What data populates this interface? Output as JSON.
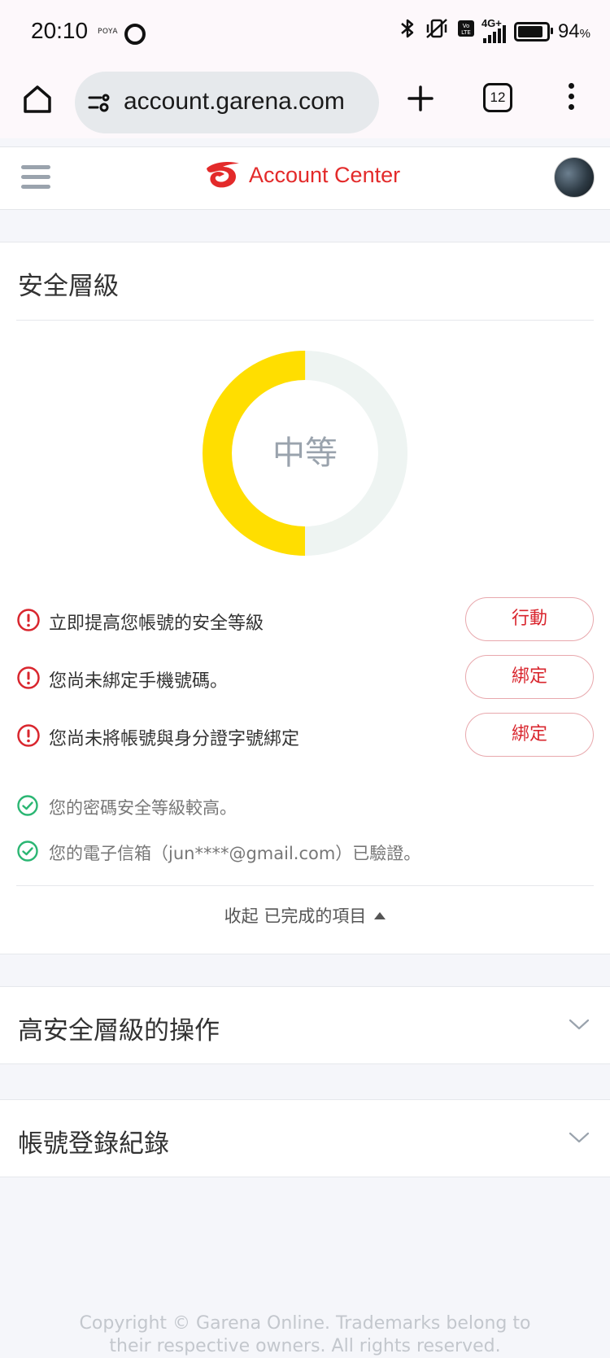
{
  "status_bar": {
    "time": "20:10",
    "carrier_label": "POYA",
    "network": "4G+",
    "battery": "94",
    "battery_unit": "%",
    "battery_level": 0.94
  },
  "browser": {
    "url": "account.garena.com",
    "tab_count": "12"
  },
  "header": {
    "title": "Account Center",
    "brand_color": "#e32a2a"
  },
  "security": {
    "title": "安全層級",
    "level_label": "中等",
    "level_fraction": 0.5,
    "level_color": "#ffde00",
    "track_color": "#eef4f2",
    "tasks": [
      {
        "text": "立即提高您帳號的安全等級",
        "button": "行動"
      },
      {
        "text": "您尚未綁定手機號碼。",
        "button": "綁定"
      },
      {
        "text": "您尚未將帳號與身分證字號綁定",
        "button": "綁定"
      }
    ],
    "completed": [
      {
        "text": "您的密碼安全等級較高。"
      },
      {
        "text": "您的電子信箱（jun****@gmail.com）已驗證。"
      }
    ],
    "collapse_label": "收起 已完成的項目"
  },
  "sections": [
    {
      "title": "高安全層級的操作"
    },
    {
      "title": "帳號登錄紀錄"
    }
  ],
  "footer": {
    "line1": "Copyright © Garena Online. Trademarks belong to",
    "line2": "their respective owners. All rights reserved."
  },
  "colors": {
    "alert": "#d9262e",
    "success": "#2bb673"
  }
}
